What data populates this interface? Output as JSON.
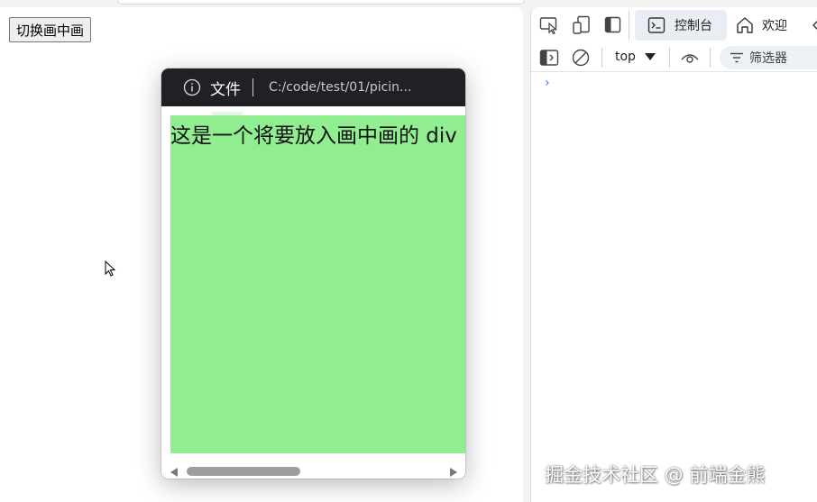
{
  "page": {
    "toggle_button_label": "切换画中画"
  },
  "pip_window": {
    "file_label": "文件",
    "url": "C:/code/test/01/picin...",
    "content_text": "这是一个将要放入画中画的 div"
  },
  "devtools": {
    "tabs": [
      {
        "label": "控制台",
        "icon": "console-icon",
        "selected": true
      },
      {
        "label": "欢迎",
        "icon": "home-icon",
        "selected": false
      }
    ],
    "context_label": "top",
    "filter_label": "筛选器",
    "prompt_symbol": "›"
  },
  "watermark": "掘金技术社区 @ 前端金熊",
  "colors": {
    "pip_content": "#90ee90",
    "pip_titlebar": "#202124",
    "console_tab_bg": "#e9eef4"
  }
}
